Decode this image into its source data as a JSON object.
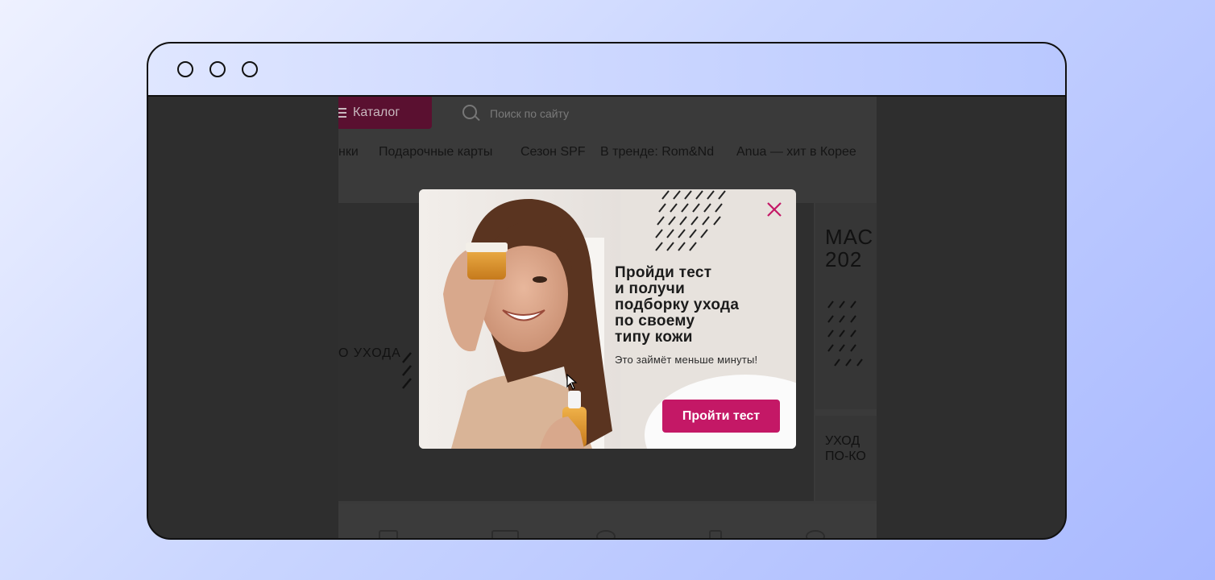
{
  "site": {
    "catalog_label": "Каталог",
    "search_placeholder": "Поиск по сайту",
    "nav": [
      "нки",
      "Подарочные карты",
      "Сезон SPF",
      "В тренде: Rom&Nd",
      "Anua — хит в Корее"
    ],
    "hero_left_text": "О УХОДА",
    "hero_right_title": "МАС\n202",
    "hero_right_sub": "УХОД\nПО-КО"
  },
  "popup": {
    "heading": "Пройди тест\nи получи\nподборку ухода\nпо своему\nтипу кожи",
    "subtext": "Это займёт меньше минуты!",
    "cta_label": "Пройти тест"
  },
  "colors": {
    "accent": "#c41866",
    "overlay": "#2e2e2e",
    "popup_bg": "#e7e2dd"
  }
}
